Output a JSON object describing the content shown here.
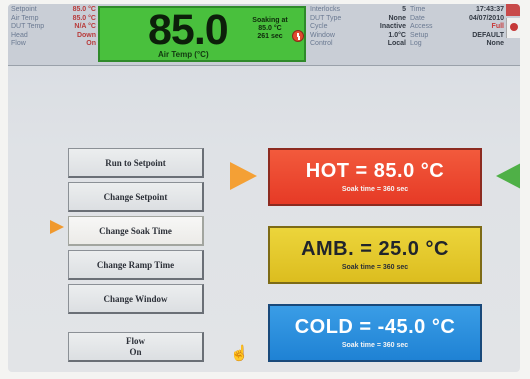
{
  "status": {
    "left": [
      {
        "label": "Setpoint",
        "value": "85.0 °C"
      },
      {
        "label": "Air Temp",
        "value": "85.0 °C"
      },
      {
        "label": "DUT Temp",
        "value": "N/A °C"
      },
      {
        "label": "Head",
        "value": "Down"
      },
      {
        "label": "Flow",
        "value": "On"
      }
    ],
    "readout": {
      "value": "85.0",
      "label": "Air Temp (°C)",
      "soak_line1": "Soaking at",
      "soak_line2": "85.0 °C",
      "soak_line3": "261 sec"
    },
    "middle": [
      {
        "label": "Interlocks",
        "value": "5"
      },
      {
        "label": "DUT Type",
        "value": "None"
      },
      {
        "label": "Cycle",
        "value": "Inactive"
      },
      {
        "label": "Window",
        "value": "1.0°C"
      },
      {
        "label": "Control",
        "value": "Local"
      }
    ],
    "right": [
      {
        "label": "Time",
        "value": "17:43:37"
      },
      {
        "label": "Date",
        "value": "04/07/2010"
      },
      {
        "label": "Access",
        "value": "Full"
      },
      {
        "label": "Setup",
        "value": "DEFAULT"
      },
      {
        "label": "Log",
        "value": "None"
      }
    ]
  },
  "commands": {
    "run_to_setpoint": "Run to Setpoint",
    "change_setpoint": "Change Setpoint",
    "change_soak_time": "Change Soak Time",
    "change_ramp_time": "Change Ramp Time",
    "change_window": "Change Window",
    "flow_line1": "Flow",
    "flow_line2": "On"
  },
  "tiles": {
    "hot": {
      "label": "HOT = 85.0 °C",
      "sub": "Soak time = 360 sec"
    },
    "amb": {
      "label": "AMB. = 25.0 °C",
      "sub": "Soak time = 360 sec"
    },
    "cold": {
      "label": "COLD = -45.0 °C",
      "sub": "Soak time = 360 sec"
    }
  },
  "colors": {
    "readout_bg": "#49c03d",
    "hot": "#e63a26",
    "amb": "#dcbd1f",
    "cold": "#1f82d4",
    "selected_marker": "#f0992e",
    "active_marker": "#4fb047"
  },
  "icons": [
    "clock-icon",
    "alarm-icon",
    "hand-pointer-icon",
    "selection-arrow-icon"
  ]
}
